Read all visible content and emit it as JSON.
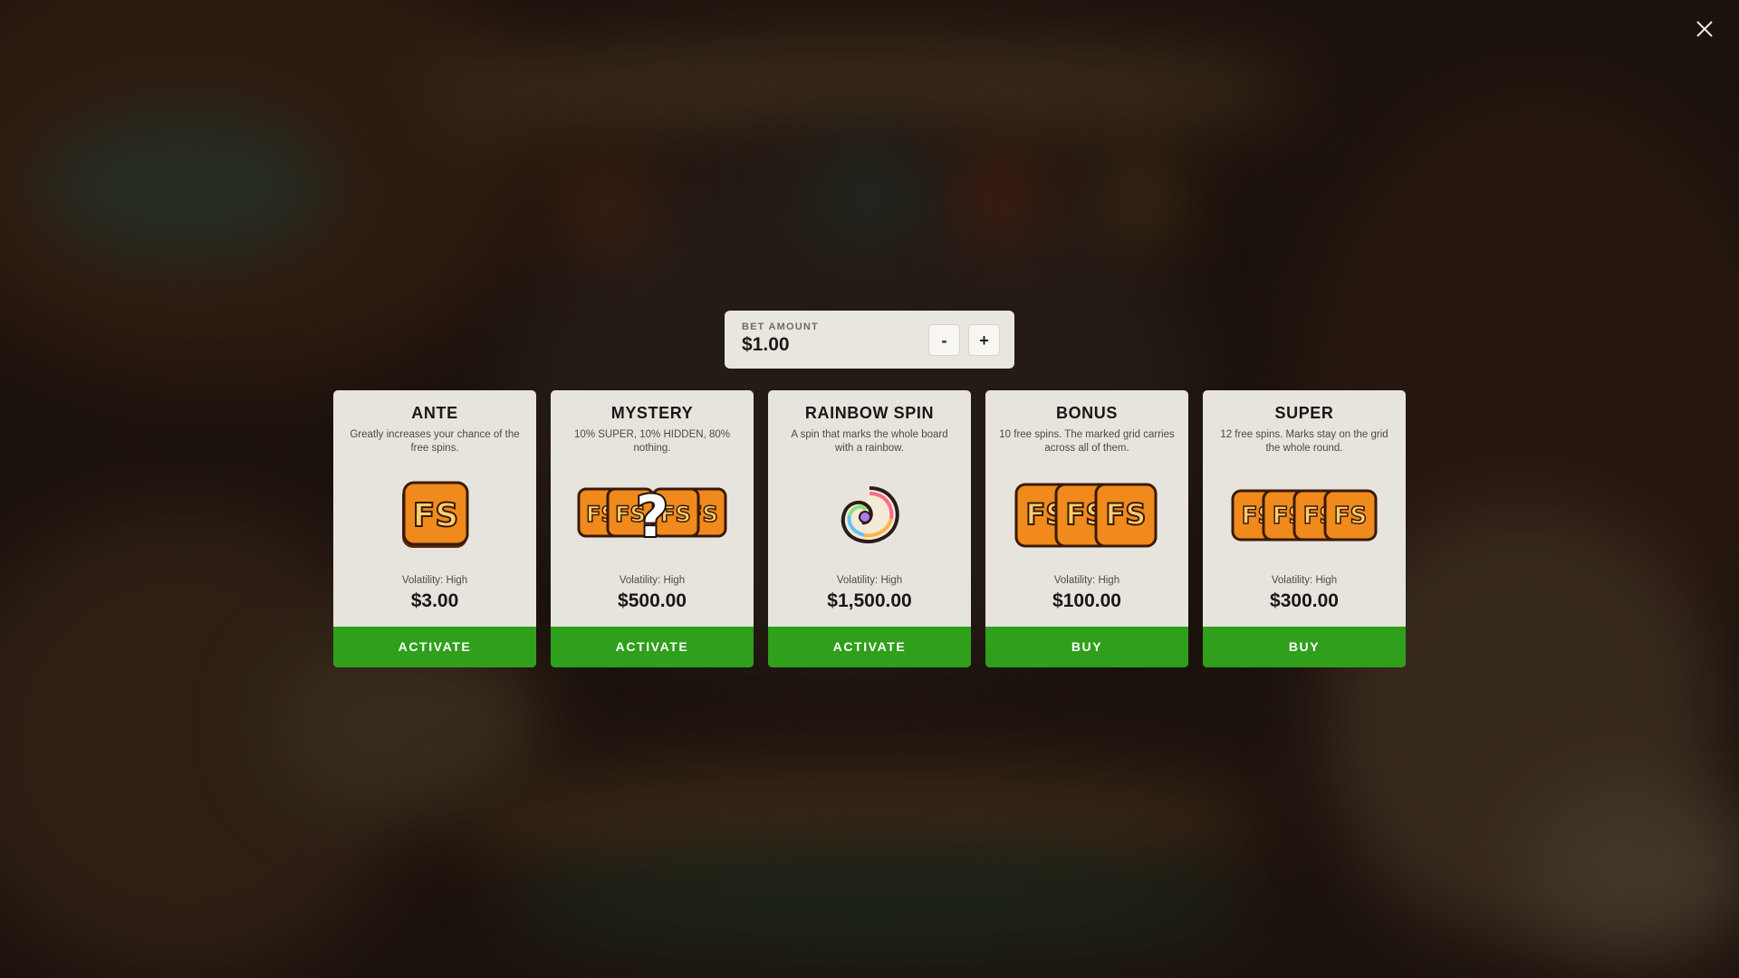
{
  "modal": {
    "close_icon": "close-icon",
    "bet": {
      "label": "BET AMOUNT",
      "value": "$1.00",
      "minus_label": "-",
      "plus_label": "+"
    },
    "cards": [
      {
        "title": "ANTE",
        "description": "Greatly increases your chance of the free spins.",
        "volatility": "Volatility: High",
        "price": "$3.00",
        "button": "ACTIVATE",
        "icon": "fs-tile-icon"
      },
      {
        "title": "MYSTERY",
        "description": "10% SUPER, 10% HIDDEN, 80% nothing.",
        "volatility": "Volatility: High",
        "price": "$500.00",
        "button": "ACTIVATE",
        "icon": "fs-mystery-icon"
      },
      {
        "title": "RAINBOW SPIN",
        "description": "A spin that marks the whole board with a rainbow.",
        "volatility": "Volatility: High",
        "price": "$1,500.00",
        "button": "ACTIVATE",
        "icon": "rainbow-shell-icon"
      },
      {
        "title": "BONUS",
        "description": "10 free spins. The marked grid carries across all of them.",
        "volatility": "Volatility: High",
        "price": "$100.00",
        "button": "BUY",
        "icon": "fs-triple-icon"
      },
      {
        "title": "SUPER",
        "description": "12 free spins. Marks stay on the grid the whole round.",
        "volatility": "Volatility: High",
        "price": "$300.00",
        "button": "BUY",
        "icon": "fs-quad-icon"
      }
    ]
  },
  "colors": {
    "button_green": "#2f9f1c",
    "card_bg": "#e7e4dd",
    "tile_orange": "#f08a1c"
  }
}
